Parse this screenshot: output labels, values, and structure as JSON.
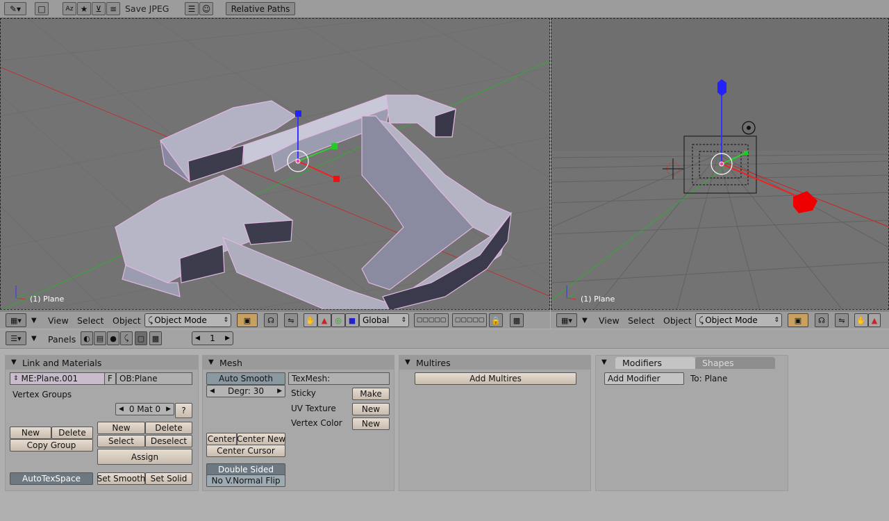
{
  "topbar": {
    "save_format": "Save JPEG",
    "relative_paths": "Relative Paths"
  },
  "viewport_left": {
    "label": "(1) Plane"
  },
  "viewport_right": {
    "label": "(1) Plane"
  },
  "view_header": {
    "menu_view": "View",
    "menu_select": "Select",
    "menu_object": "Object",
    "mode": "Object Mode",
    "orientation": "Global"
  },
  "buttons_header": {
    "panels": "Panels",
    "frame": "1"
  },
  "link_materials": {
    "title": "Link and Materials",
    "mesh_name": "ME:Plane.001",
    "fake_flag": "F",
    "object_name": "OB:Plane",
    "vertex_groups": "Vertex Groups",
    "mat_counter": "0 Mat 0",
    "mat_help": "?",
    "vg_new": "New",
    "vg_delete": "Delete",
    "copy_group": "Copy Group",
    "mat_new": "New",
    "mat_delete": "Delete",
    "mat_select": "Select",
    "mat_deselect": "Deselect",
    "assign": "Assign",
    "auto_tex_space": "AutoTexSpace",
    "set_smooth": "Set Smooth",
    "set_solid": "Set Solid"
  },
  "mesh": {
    "title": "Mesh",
    "auto_smooth": "Auto Smooth",
    "degr": "Degr: 30",
    "tex_mesh": "TexMesh:",
    "sticky": "Sticky",
    "sticky_make": "Make",
    "uv_texture": "UV Texture",
    "uv_new": "New",
    "vertex_color": "Vertex Color",
    "vc_new": "New",
    "center": "Center",
    "center_new": "Center New",
    "center_cursor": "Center Cursor",
    "double_sided": "Double Sided",
    "no_vnormal_flip": "No V.Normal Flip"
  },
  "multires": {
    "title": "Multires",
    "add_multires": "Add Multires"
  },
  "modifiers": {
    "tab_modifiers": "Modifiers",
    "tab_shapes": "Shapes",
    "add_modifier": "Add Modifier",
    "to_target": "To: Plane"
  }
}
